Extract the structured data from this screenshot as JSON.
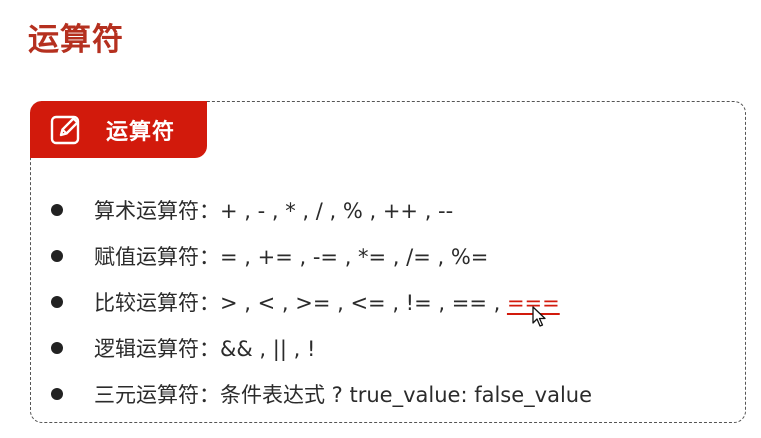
{
  "page": {
    "title": "运算符"
  },
  "card": {
    "header_label": "运算符",
    "header_icon": "edit-icon",
    "colors": {
      "accent": "#d21a0c",
      "title": "#b5301f",
      "text": "#2b2b2b",
      "border": "#555555"
    },
    "items": [
      {
        "label": "算术运算符：",
        "ops": "+ , - , * , / , % , ++ , --",
        "highlight": ""
      },
      {
        "label": "赋值运算符：",
        "ops": "= , += , -= , *= , /= , %=",
        "highlight": ""
      },
      {
        "label": "比较运算符：",
        "ops": "> , < , >= , <= , != , == , ",
        "highlight": "==="
      },
      {
        "label": "逻辑运算符：",
        "ops": "&& , || , !",
        "highlight": ""
      },
      {
        "label": "三元运算符：",
        "ops": "条件表达式 ? true_value: false_value",
        "highlight": ""
      }
    ]
  },
  "cursor": {
    "icon": "mouse-pointer-icon"
  }
}
